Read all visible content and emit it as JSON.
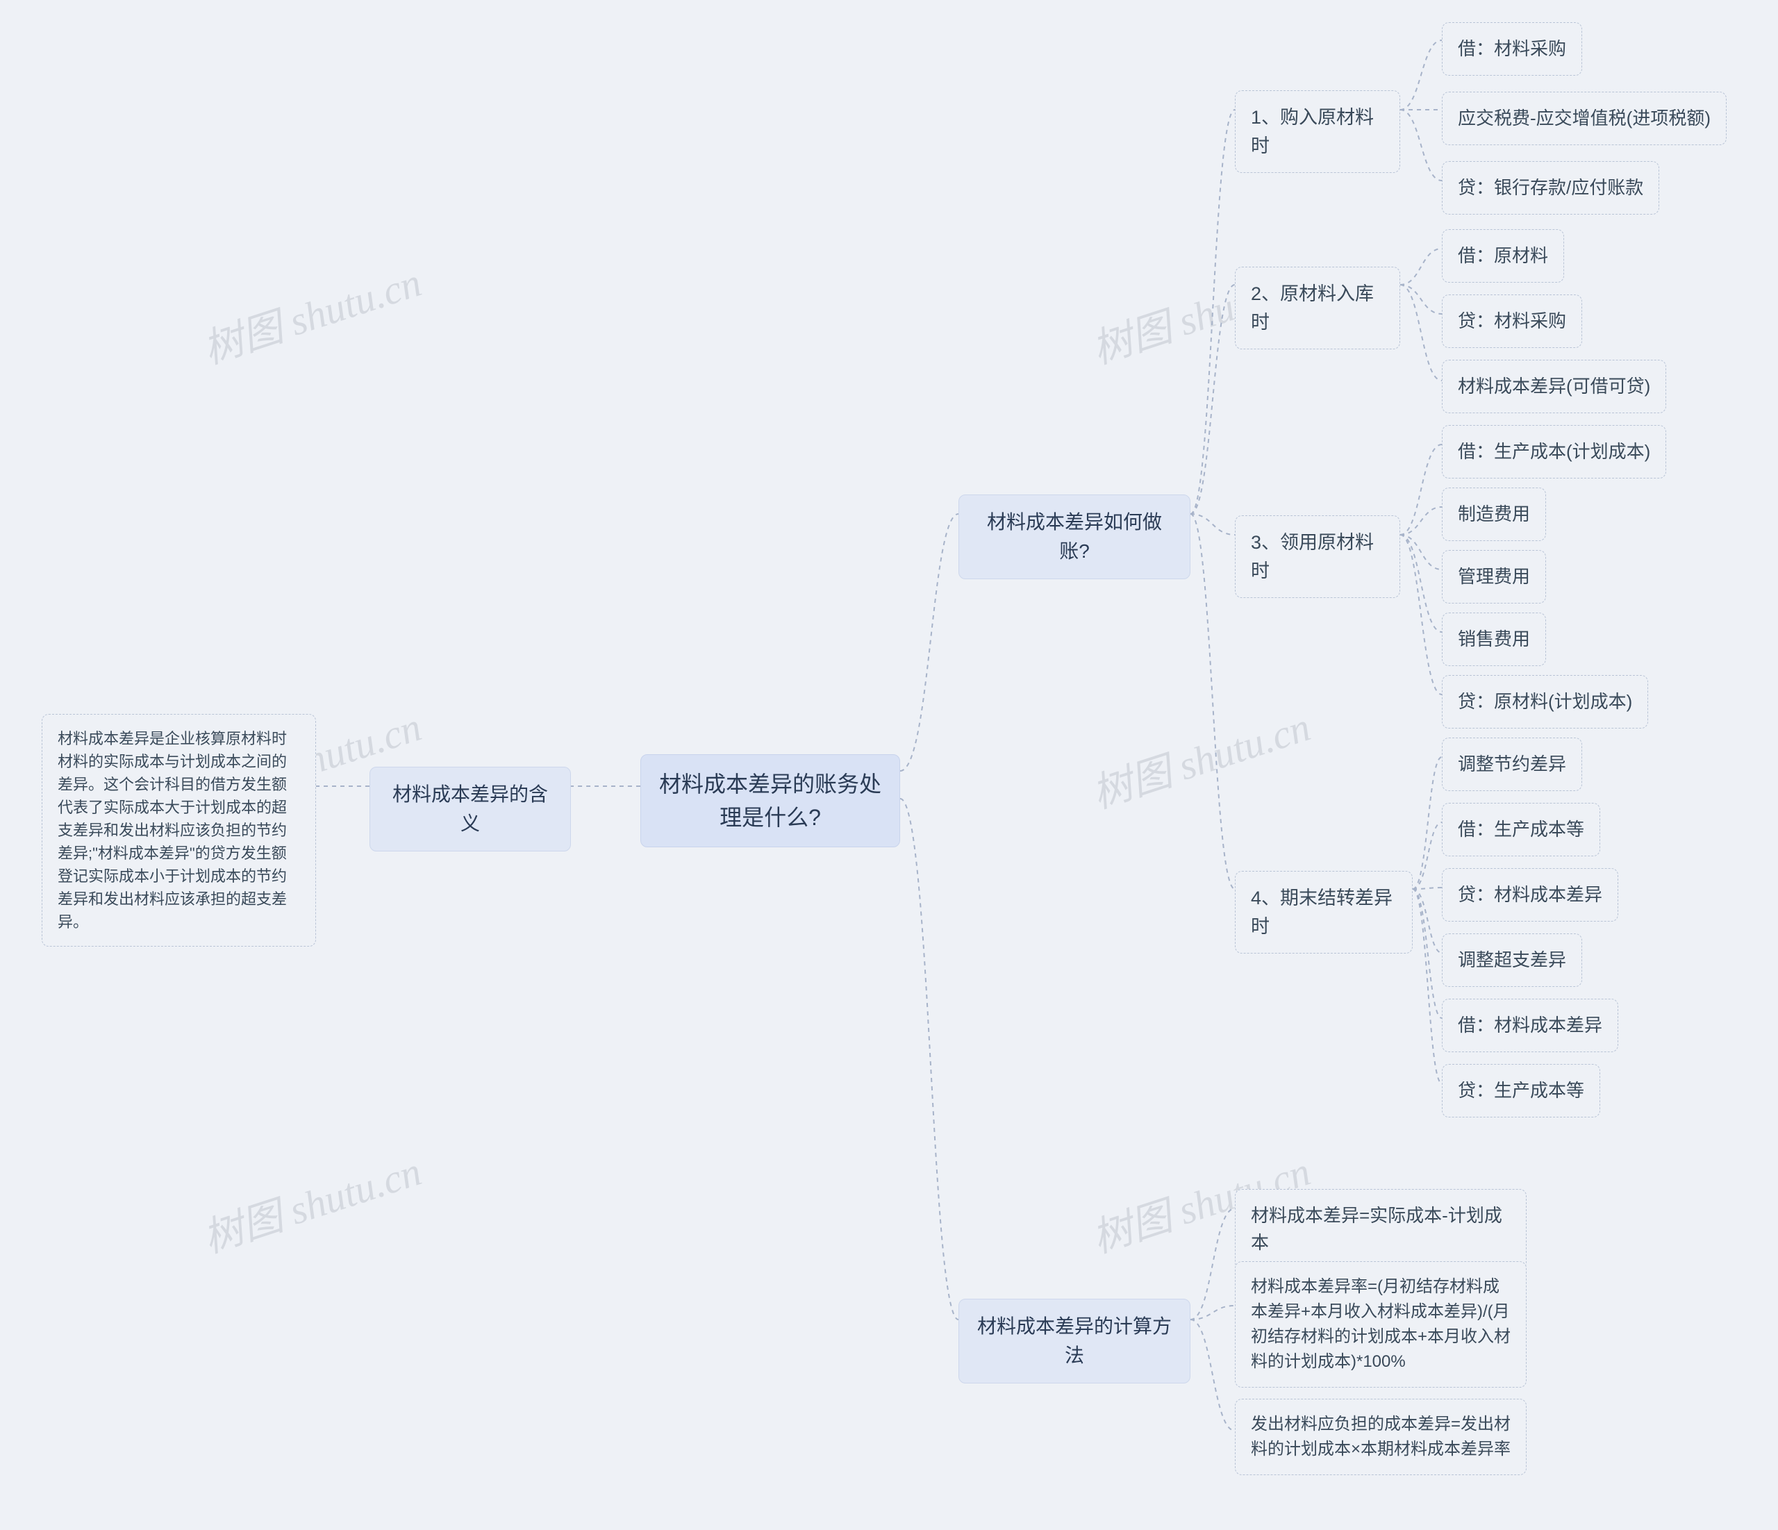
{
  "watermark": "树图 shutu.cn",
  "root": "材料成本差异的账务处理是什么?",
  "left": {
    "branch": "材料成本差异的含义",
    "desc": "材料成本差异是企业核算原材料时材料的实际成本与计划成本之间的差异。这个会计科目的借方发生额代表了实际成本大于计划成本的超支差异和发出材料应该负担的节约差异;\"材料成本差异\"的贷方发生额登记实际成本小于计划成本的节约差异和发出材料应该承担的超支差异。"
  },
  "right": {
    "branch1": {
      "label": "材料成本差异如何做账?",
      "g1": {
        "label": "1、购入原材料时",
        "items": [
          "借：材料采购",
          "应交税费-应交增值税(进项税额)",
          "贷：银行存款/应付账款"
        ]
      },
      "g2": {
        "label": "2、原材料入库时",
        "items": [
          "借：原材料",
          "贷：材料采购",
          "材料成本差异(可借可贷)"
        ]
      },
      "g3": {
        "label": "3、领用原材料时",
        "items": [
          "借：生产成本(计划成本)",
          "制造费用",
          "管理费用",
          "销售费用",
          "贷：原材料(计划成本)"
        ]
      },
      "g4": {
        "label": "4、期末结转差异时",
        "items": [
          "调整节约差异",
          "借：生产成本等",
          "贷：材料成本差异",
          "调整超支差异",
          "借：材料成本差异",
          "贷：生产成本等"
        ]
      }
    },
    "branch2": {
      "label": "材料成本差异的计算方法",
      "items": [
        "材料成本差异=实际成本-计划成本",
        "材料成本差异率=(月初结存材料成本差异+本月收入材料成本差异)/(月初结存材料的计划成本+本月收入材料的计划成本)*100%",
        "发出材料应负担的成本差异=发出材料的计划成本×本期材料成本差异率"
      ]
    }
  }
}
